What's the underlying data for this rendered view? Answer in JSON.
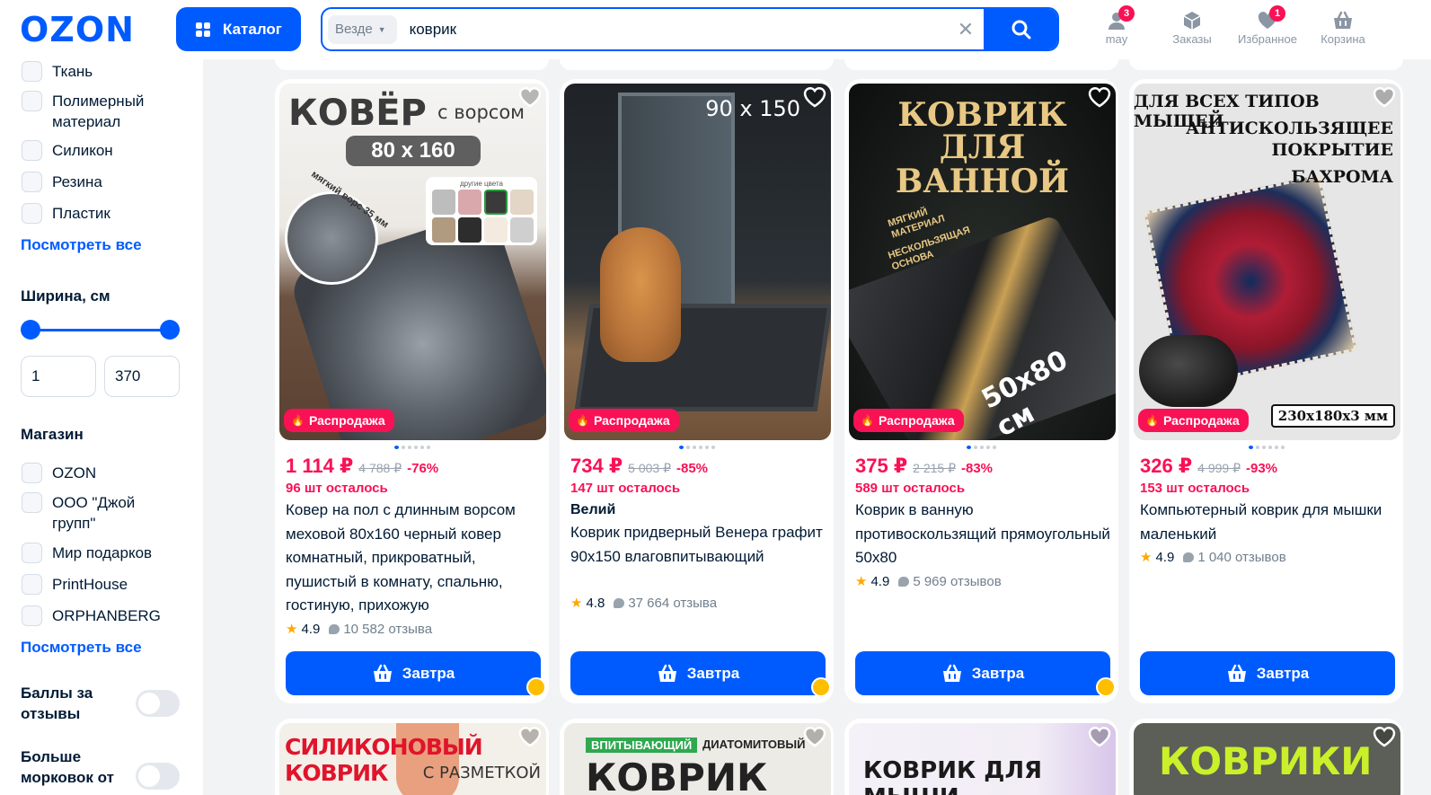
{
  "header": {
    "logo": "OZON",
    "catalog_label": "Каталог",
    "search_scope": "Везде",
    "search_value": "коврик",
    "nav": [
      {
        "label": "may",
        "icon": "user-icon",
        "badge": "3"
      },
      {
        "label": "Заказы",
        "icon": "box-icon",
        "badge": ""
      },
      {
        "label": "Избранное",
        "icon": "heart-icon",
        "badge": "1"
      },
      {
        "label": "Корзина",
        "icon": "cart-icon",
        "badge": ""
      }
    ]
  },
  "sidebar": {
    "materials": [
      "Ткань",
      "Полимерный материал",
      "Силикон",
      "Резина",
      "Пластик"
    ],
    "see_all_1": "Посмотреть все",
    "width_title": "Ширина, см",
    "width_min": "1",
    "width_max": "370",
    "shop_title": "Магазин",
    "shops": [
      "OZON",
      "ООО \"Джой групп\"",
      "Мир подарков",
      "PrintHouse",
      "ORPHANBERG"
    ],
    "see_all_2": "Посмотреть все",
    "toggle_1": "Баллы за отзывы",
    "toggle_2": "Больше морковок от"
  },
  "products": [
    {
      "badge": "Распродажа",
      "price": "1 114 ₽",
      "old_price": "4 788 ₽",
      "discount": "-76%",
      "left": "96 шт осталось",
      "brand": "",
      "title": "Ковер на пол с длинным ворсом меховой 80х160 черный ковер комнатный, прикроватный, пушистый в комнату, спальню, гостиную, прихожую",
      "rating": "4.9",
      "reviews": "10 582 отзыва",
      "button": "Завтра",
      "img": {
        "t1": "КОВЁР",
        "t2": "с ворсом",
        "t3": "80 x 160",
        "t4": "мягкий ворс 35 мм",
        "t5": "другие цвета"
      }
    },
    {
      "badge": "Распродажа",
      "price": "734 ₽",
      "old_price": "5 003 ₽",
      "discount": "-85%",
      "left": "147 шт осталось",
      "brand": "Велий",
      "title": "Коврик придверный Венера графит 90х150 влаговпитывающий",
      "rating": "4.8",
      "reviews": "37 664 отзыва",
      "button": "Завтра",
      "img": {
        "t1": "90 x 150"
      }
    },
    {
      "badge": "Распродажа",
      "price": "375 ₽",
      "old_price": "2 215 ₽",
      "discount": "-83%",
      "left": "589 шт осталось",
      "brand": "",
      "title": "Коврик в ванную противоскользящий прямоугольный 50х80",
      "rating": "4.9",
      "reviews": "5 969 отзывов",
      "button": "Завтра",
      "img": {
        "t1": "КОВРИК",
        "t2": "ДЛЯ ВАННОЙ",
        "t3": "МЯГКИЙ МАТЕРИАЛ",
        "t4": "НЕСКОЛЬЗЯЩАЯ ОСНОВА",
        "t5": "50x80 см"
      }
    },
    {
      "badge": "Распродажа",
      "price": "326 ₽",
      "old_price": "4 999 ₽",
      "discount": "-93%",
      "left": "153 шт осталось",
      "brand": "",
      "title": "Компьютерный коврик для мышки маленький",
      "rating": "4.9",
      "reviews": "1 040 отзывов",
      "button": "Завтра",
      "img": {
        "t1": "ДЛЯ ВСЕХ ТИПОВ МЫШЕЙ",
        "t2": "АНТИСКОЛЬЗЯЩЕЕ",
        "t3": "ПОКРЫТИЕ",
        "t4": "БАХРОМА",
        "t5": "230x180x3 мм"
      }
    }
  ],
  "next_row": [
    {
      "t1": "СИЛИКОНОВЫЙ КОВРИК",
      "t2": "С РАЗМЕТКОЙ"
    },
    {
      "t1": "ВПИТЫВАЮЩИЙ",
      "t2": "ДИАТОМИТОВЫЙ",
      "t3": "КОВРИК"
    },
    {
      "t1": "КОВРИК ДЛЯ МЫШИ"
    },
    {
      "t1": "КОВРИКИ"
    }
  ],
  "colors": {
    "brand": "#005bff",
    "sale": "#f91155",
    "star": "#ffa800"
  }
}
